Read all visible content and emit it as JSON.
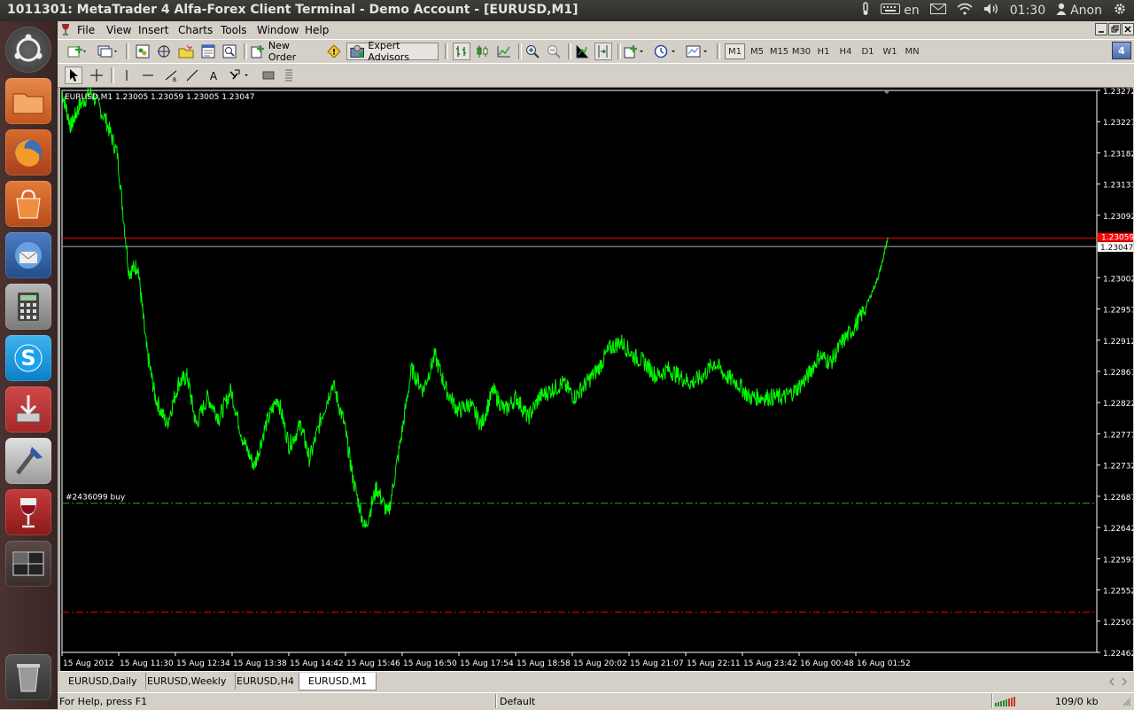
{
  "window": {
    "title": "1011301: MetaTrader 4 Alfa-Forex Client Terminal - Demo Account - [EURUSD,M1]"
  },
  "tray": {
    "keyboard": "en",
    "clock": "01:30",
    "user": "Anon"
  },
  "menu": [
    "File",
    "View",
    "Insert",
    "Charts",
    "Tools",
    "Window",
    "Help"
  ],
  "toolbar": {
    "new_order": "New Order",
    "expert_advisors": "Expert Advisors",
    "timeframes": [
      "M1",
      "M5",
      "M15",
      "M30",
      "H1",
      "H4",
      "D1",
      "W1",
      "MN"
    ],
    "active_timeframe": "M1",
    "window_badge": "4"
  },
  "colors": {
    "chart_bg": "#000000",
    "price_line": "#00ff00",
    "ask_line": "#ff0000",
    "bid_line": "#a0b4c8",
    "order_line": "#00c800",
    "stop_line": "#ff0000",
    "axis_text": "#ffffff"
  },
  "chart": {
    "header": "EURUSD,M1  1.23005 1.23059 1.23005 1.23047",
    "order_label": "#2436099 buy",
    "current_price_label": "1.23047",
    "ask_label": "1.23059"
  },
  "chart_data": {
    "type": "line",
    "symbol": "EURUSD",
    "timeframe": "M1",
    "ohlc": {
      "open": 1.23005,
      "high": 1.23059,
      "low": 1.23005,
      "close": 1.23047
    },
    "y_ticks": [
      "1.23272",
      "1.23227",
      "1.23182",
      "1.23137",
      "1.23092",
      "1.23047",
      "1.23002",
      "1.22957",
      "1.22912",
      "1.22867",
      "1.22822",
      "1.22777",
      "1.22732",
      "1.22687",
      "1.22642",
      "1.22597",
      "1.22552",
      "1.22507",
      "1.22462"
    ],
    "x_ticks": [
      "15 Aug 2012",
      "15 Aug 11:30",
      "15 Aug 12:34",
      "15 Aug 13:38",
      "15 Aug 14:42",
      "15 Aug 15:46",
      "15 Aug 16:50",
      "15 Aug 17:54",
      "15 Aug 18:58",
      "15 Aug 20:02",
      "15 Aug 21:07",
      "15 Aug 22:11",
      "15 Aug 23:42",
      "16 Aug 00:48",
      "16 Aug 01:52"
    ],
    "ylim": [
      1.22462,
      1.23272
    ],
    "levels": {
      "ask": 1.23059,
      "bid": 1.23047,
      "order_buy": 1.22677,
      "stop_loss": 1.2252
    },
    "series": [
      {
        "values": [
          [
            0,
            1.2327
          ],
          [
            0.3,
            1.2322
          ],
          [
            0.6,
            1.2325
          ],
          [
            1,
            1.2327
          ],
          [
            1.5,
            1.2323
          ],
          [
            1.9,
            1.2318
          ],
          [
            2.3,
            1.2301
          ],
          [
            2.6,
            1.2302
          ],
          [
            2.9,
            1.229
          ],
          [
            3.2,
            1.2283
          ],
          [
            3.6,
            1.2279
          ],
          [
            4.0,
            1.2285
          ],
          [
            4.3,
            1.2286
          ],
          [
            4.6,
            1.2279
          ],
          [
            5.0,
            1.2283
          ],
          [
            5.4,
            1.228
          ],
          [
            5.8,
            1.2284
          ],
          [
            6.2,
            1.2277
          ],
          [
            6.6,
            1.2273
          ],
          [
            7.0,
            1.2279
          ],
          [
            7.4,
            1.2283
          ],
          [
            7.8,
            1.2276
          ],
          [
            8.2,
            1.2279
          ],
          [
            8.5,
            1.2274
          ],
          [
            8.9,
            1.228
          ],
          [
            9.3,
            1.2285
          ],
          [
            9.7,
            1.2279
          ],
          [
            10.0,
            1.2271
          ],
          [
            10.4,
            1.2264
          ],
          [
            10.8,
            1.227
          ],
          [
            11.2,
            1.2266
          ],
          [
            11.6,
            1.2276
          ],
          [
            12.0,
            1.2287
          ],
          [
            12.4,
            1.2284
          ],
          [
            12.8,
            1.2289
          ],
          [
            13.2,
            1.2284
          ],
          [
            13.6,
            1.2281
          ],
          [
            14.0,
            1.2282
          ],
          [
            14.4,
            1.2279
          ],
          [
            14.8,
            1.2284
          ],
          [
            15.2,
            1.2281
          ],
          [
            15.6,
            1.2283
          ],
          [
            16.0,
            1.228
          ],
          [
            16.4,
            1.2283
          ],
          [
            16.8,
            1.2284
          ],
          [
            17.2,
            1.2285
          ],
          [
            17.6,
            1.2283
          ],
          [
            18.0,
            1.2285
          ],
          [
            18.4,
            1.2287
          ],
          [
            18.8,
            1.229
          ],
          [
            19.2,
            1.2291
          ],
          [
            19.6,
            1.2289
          ],
          [
            20.0,
            1.2288
          ],
          [
            20.4,
            1.2286
          ],
          [
            20.8,
            1.2287
          ],
          [
            21.2,
            1.2286
          ],
          [
            21.6,
            1.2285
          ],
          [
            22.0,
            1.2286
          ],
          [
            22.4,
            1.2288
          ],
          [
            22.8,
            1.2286
          ],
          [
            23.2,
            1.2285
          ],
          [
            23.6,
            1.2283
          ],
          [
            24.0,
            1.2283
          ],
          [
            24.4,
            1.2283
          ],
          [
            24.8,
            1.2283
          ],
          [
            25.2,
            1.2284
          ],
          [
            25.6,
            1.2286
          ],
          [
            26.0,
            1.2289
          ],
          [
            26.4,
            1.2288
          ],
          [
            26.8,
            1.2291
          ],
          [
            27.2,
            1.2293
          ],
          [
            27.6,
            1.2296
          ],
          [
            28.0,
            1.23
          ],
          [
            28.2,
            1.2303
          ],
          [
            28.35,
            1.2306
          ]
        ]
      }
    ]
  },
  "tabs": [
    "EURUSD,Daily",
    "EURUSD,Weekly",
    "EURUSD,H4",
    "EURUSD,M1"
  ],
  "active_tab": "EURUSD,M1",
  "status": {
    "help": "For Help, press F1",
    "profile": "Default",
    "traffic": "109/0 kb"
  }
}
